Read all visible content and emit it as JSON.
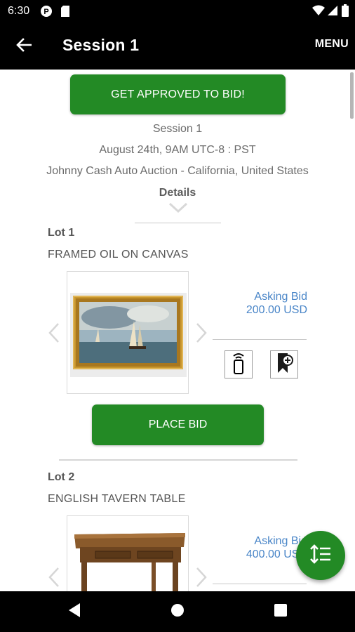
{
  "status_bar": {
    "time": "6:30",
    "icons": [
      "notification-p-icon",
      "sd-card-icon",
      "wifi-icon",
      "signal-icon",
      "battery-icon"
    ]
  },
  "app_bar": {
    "title": "Session 1",
    "menu_label": "MENU",
    "back_icon": "arrow-back-icon"
  },
  "session": {
    "approve_button": "GET APPROVED TO BID!",
    "name": "Session 1",
    "date": "August 24th, 9AM UTC-8 : PST",
    "location": "Johnny Cash Auto Auction - California, United States",
    "details_label": "Details"
  },
  "lots": [
    {
      "number": "Lot 1",
      "title": "FRAMED OIL ON CANVAS",
      "asking_label": "Asking Bid",
      "asking_value": "200.00 USD",
      "place_bid_label": "PLACE BID"
    },
    {
      "number": "Lot 2",
      "title": "ENGLISH TAVERN TABLE",
      "asking_label": "Asking Bid",
      "asking_value": "400.00 USD"
    }
  ],
  "colors": {
    "brand_green": "#238a25",
    "link_blue": "#4a86c8",
    "bar_black": "#000000"
  }
}
